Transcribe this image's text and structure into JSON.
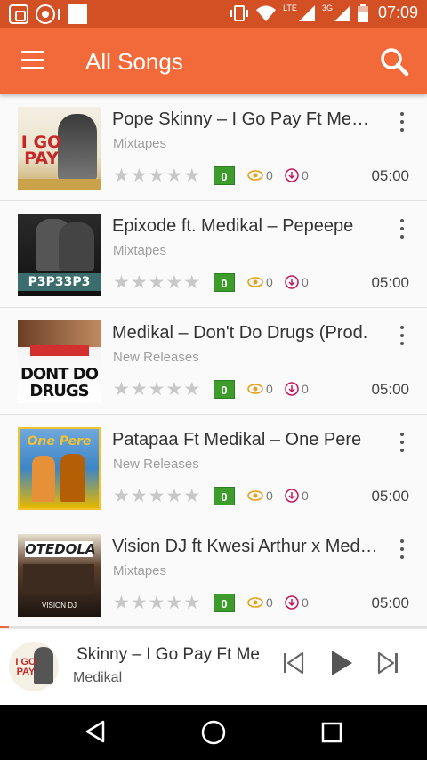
{
  "status_bar": {
    "network_label": "LTE",
    "network_label_2": "3G",
    "time": "07:09"
  },
  "app_bar": {
    "title": "All Songs",
    "menu_icon": "hamburger-menu-icon",
    "search_icon": "search-icon"
  },
  "colors": {
    "status_bar": "#d35024",
    "app_bar": "#f26a3a",
    "badge": "#3e9c2d",
    "accent": "#f26a3a"
  },
  "songs": [
    {
      "title": "Pope Skinny – I Go Pay Ft Medikal",
      "category": "Mixtapes",
      "badge": "0",
      "views": "0",
      "downloads": "0",
      "duration": "05:00",
      "art_text": "I GO PAY"
    },
    {
      "title": "Epixode ft. Medikal – Pepeepe",
      "category": "Mixtapes",
      "badge": "0",
      "views": "0",
      "downloads": "0",
      "duration": "05:00",
      "art_text": "P3P33P3"
    },
    {
      "title": "Medikal – Don't Do Drugs (Prod.",
      "category": "New Releases",
      "badge": "0",
      "views": "0",
      "downloads": "0",
      "duration": "05:00",
      "art_text": "DONT DO DRUGS"
    },
    {
      "title": "Patapaa Ft Medikal – One Pere",
      "category": "New Releases",
      "badge": "0",
      "views": "0",
      "downloads": "0",
      "duration": "05:00",
      "art_text": "One Pere"
    },
    {
      "title": "Vision DJ ft Kwesi Arthur x Medikal",
      "category": "Mixtapes",
      "badge": "0",
      "views": "0",
      "downloads": "0",
      "duration": "05:00",
      "art_text": "OTEDOLA"
    }
  ],
  "player": {
    "title": "Pope Skinny – I Go Pay Ft Me",
    "artist": "Medikal",
    "progress": 0.02,
    "prev_icon": "skip-previous-icon",
    "play_icon": "play-icon",
    "next_icon": "skip-next-icon"
  },
  "nav": {
    "back_icon": "back-icon",
    "home_icon": "home-icon",
    "recents_icon": "recents-icon"
  }
}
